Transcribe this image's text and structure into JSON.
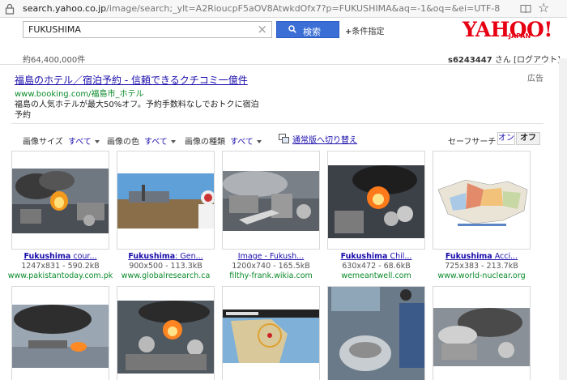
{
  "browser": {
    "url_host": "search.yahoo.co.jp",
    "url_path": "/image/search;_ylt=A2RioucpF5aOV8AtwkdOfx7?p=FUKUSHIMA&aq=-1&oq=&ei=UTF-8",
    "icons": [
      "lock-icon",
      "book-icon",
      "star-icon"
    ]
  },
  "header": {
    "query": "FUKUSHIMA",
    "search_button": "検索",
    "conditions_link": "条件指定",
    "logo_main": "YAHOO!",
    "logo_sub": "JAPAN",
    "brand_color": "#e60012",
    "button_color": "#3b6fd6"
  },
  "stats": {
    "result_count": "約64,400,000件",
    "user_id": "s6243447",
    "user_suffix": "さん",
    "logout": "[ログアウト]"
  },
  "ad": {
    "title": "福島のホテル／宿泊予約 - 信頼できるクチコミ一億件",
    "url": "www.booking.com/福島市_ホテル",
    "desc": "福島の人気ホテルが最大50%オフ。予約手数料なしでおトクに宿泊予約",
    "label": "広告"
  },
  "filters": {
    "size_label": "画像サイズ",
    "size_value": "すべて",
    "color_label": "画像の色",
    "color_value": "すべて",
    "type_label": "画像の種類",
    "type_value": "すべて",
    "switch_label": "通常版へ切り替え",
    "safe_label": "セーフサーチ",
    "safe_on": "オン",
    "safe_off": "オフ"
  },
  "results": [
    {
      "title_bold": "Fukushima",
      "title_rest": " cour...",
      "size": "1247x831 - 590.2kB",
      "domain": "www.pakistantoday.com.pk",
      "kind": "plant-fire"
    },
    {
      "title_bold": "Fukushima",
      "title_rest": ": Gen...",
      "size": "900x500 - 113.3kB",
      "domain": "www.globalresearch.ca",
      "kind": "worker"
    },
    {
      "title_bold": "",
      "title_rest": "Image - Fukush...",
      "size": "1200x740 - 165.5kB",
      "domain": "filthy-frank.wikia.com",
      "kind": "plant-smoke"
    },
    {
      "title_bold": "Fukushima",
      "title_rest": " Chil...",
      "size": "630x472 - 68.6kB",
      "domain": "wemeantwell.com",
      "kind": "plant-blaze"
    },
    {
      "title_bold": "Fukushima",
      "title_rest": " Acci...",
      "size": "725x383 - 213.7kB",
      "domain": "www.world-nuclear.org",
      "kind": "map"
    },
    {
      "kind": "coast-fire"
    },
    {
      "kind": "plant-fire2"
    },
    {
      "kind": "evac-map"
    },
    {
      "kind": "fish"
    },
    {
      "kind": "plant-smoke2"
    }
  ]
}
